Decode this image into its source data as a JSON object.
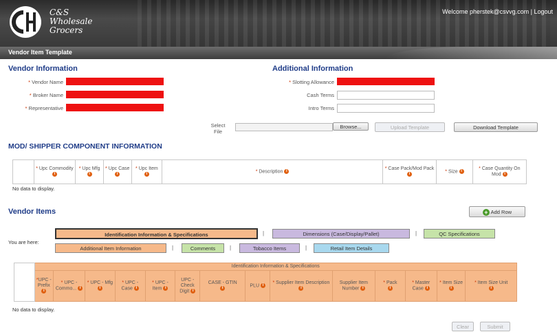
{
  "header": {
    "logo_line1": "C&S",
    "logo_line2": "Wholesale",
    "logo_line3": "Grocers",
    "welcome": "Welcome pherstek@csvvg.com | Logout"
  },
  "page_title": "Vendor Item Template",
  "vendor_info": {
    "heading": "Vendor Information",
    "fields": [
      "Vendor Name",
      "Broker Name",
      "Representative"
    ]
  },
  "additional_info": {
    "heading": "Additional Information",
    "slotting": "Slotting Allowance",
    "cash_terms": "Cash Terms",
    "intro_terms": "Intro Terms"
  },
  "file": {
    "label_line1": "Select",
    "label_line2": "File",
    "browse": "Browse...",
    "upload": "Upload Template",
    "download": "Download Template"
  },
  "mod": {
    "heading": "MOD/ SHIPPER COMPONENT INFORMATION",
    "columns": [
      "Upc Commodity",
      "Upc Mfg",
      "Upc Case",
      "Upc Item",
      "Description",
      "Case Pack/Mod Pack",
      "Size",
      "Case Quantity On Mod"
    ],
    "nodata": "No data to display."
  },
  "vendor_items": {
    "heading": "Vendor Items",
    "add_row": "Add Row",
    "you_are_here": "You are here:",
    "tabs_row1": [
      "Identification Information & Specifications",
      "Dimensions (Case/Display/Pallet)",
      "QC Specifications"
    ],
    "tabs_row2": [
      "Additional Item Information",
      "Comments",
      "Tobacco Items",
      "Retail Item Details"
    ],
    "group_header": "Identification Information & Specifications",
    "columns": [
      "UPC - Prefix",
      "UPC - Commo...",
      "UPC - Mfg",
      "UPC - Case",
      "UPC - Item",
      "UPC - Check Digit",
      "CASE - GTIN",
      "PLU",
      "Supplier Item Description",
      "Supplier Item Number",
      "Pack",
      "Master Case",
      "Item Size",
      "Item Size Unit"
    ],
    "nodata": "No data to display."
  },
  "footer": {
    "clear": "Clear",
    "submit": "Submit"
  },
  "colors": {
    "heading_blue": "#1f3c88",
    "required_red": "#ee1111",
    "tab_orange": "#f6b98a",
    "tab_purple": "#c9b9df",
    "tab_green": "#c6e3a8",
    "tab_blue": "#a8d8ee"
  }
}
